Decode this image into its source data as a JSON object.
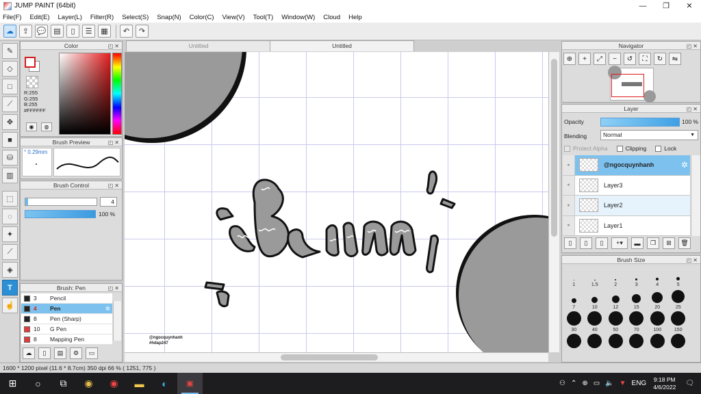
{
  "window": {
    "title": "JUMP PAINT (64bit)",
    "minimize": "—",
    "maximize": "❐",
    "close": "✕"
  },
  "menu": [
    "File(F)",
    "Edit(E)",
    "Layer(L)",
    "Filter(R)",
    "Select(S)",
    "Snap(N)",
    "Color(C)",
    "View(V)",
    "Tool(T)",
    "Window(W)",
    "Cloud",
    "Help"
  ],
  "toolbar_icons": [
    "cloud-icon",
    "export-icon",
    "comment-icon",
    "message-icon",
    "document-icon",
    "list-icon",
    "grid-check-icon",
    "undo-icon",
    "redo-icon"
  ],
  "tools": [
    "brush-icon",
    "eraser-icon",
    "rectangle-icon",
    "pipette-icon",
    "move-icon",
    "fill-rect-icon",
    "bucket-icon",
    "gradient-icon",
    "select-rect-icon",
    "lasso-icon",
    "magic-wand-icon",
    "select-pen-icon",
    "select-eraser-icon",
    "text-icon",
    "hand-select-icon"
  ],
  "color_panel": {
    "title": "Color",
    "r": "R:255",
    "g": "G:255",
    "b": "B:255",
    "hex": "#FFFFFF",
    "fg": "#ffffff",
    "accent_border": "#d51b1b"
  },
  "brush_preview": {
    "title": "Brush Preview",
    "size": "° 0.29mm"
  },
  "brush_control": {
    "title": "Brush Control",
    "size_value": "4",
    "opacity_value": "100 %",
    "size_fill": 0.04
  },
  "brush_list": {
    "title": "Brush: Pen",
    "items": [
      {
        "num": "3",
        "name": "Pencil",
        "color": "#222222"
      },
      {
        "num": "4",
        "name": "Pen",
        "color": "#222222",
        "selected": true
      },
      {
        "num": "8",
        "name": "Pen (Sharp)",
        "color": "#222222"
      },
      {
        "num": "10",
        "name": "G Pen",
        "color": "#e33b3b"
      },
      {
        "num": "8",
        "name": "Mapping Pen",
        "color": "#e33b3b"
      }
    ]
  },
  "tabs": [
    {
      "label": "Untitled",
      "active": false
    },
    {
      "label": "Untitled",
      "active": true
    }
  ],
  "canvas": {
    "watermark_line1": "@ngocquynhanh",
    "watermark_line2": "#hdap247"
  },
  "navigator": {
    "title": "Navigator"
  },
  "layer_panel": {
    "title": "Layer",
    "opacity_label": "Opacity",
    "opacity_value": "100 %",
    "opacity_fill": 1.0,
    "blending_label": "Blending",
    "blending_value": "Normal",
    "protect_alpha": "Protect Alpha",
    "clipping": "Clipping",
    "lock": "Lock",
    "layers": [
      {
        "name": "@ngocquynhanh",
        "selected": true
      },
      {
        "name": "Layer3"
      },
      {
        "name": "Layer2",
        "alt": true
      },
      {
        "name": "Layer1"
      }
    ]
  },
  "brush_size": {
    "title": "Brush Size",
    "sizes": [
      "1",
      "1.5",
      "2",
      "3",
      "4",
      "5",
      "7",
      "10",
      "12",
      "15",
      "20",
      "25",
      "30",
      "40",
      "50",
      "70",
      "100",
      "150",
      "",
      "",
      "",
      "",
      "",
      ""
    ]
  },
  "status": {
    "text": "1600 * 1200 pixel  (11.6 * 8.7cm)  350 dpi  66 %  ( 1251, 775 )"
  },
  "taskbar": {
    "lang": "ENG",
    "time": "9:18 PM",
    "date": "4/6/2022"
  }
}
